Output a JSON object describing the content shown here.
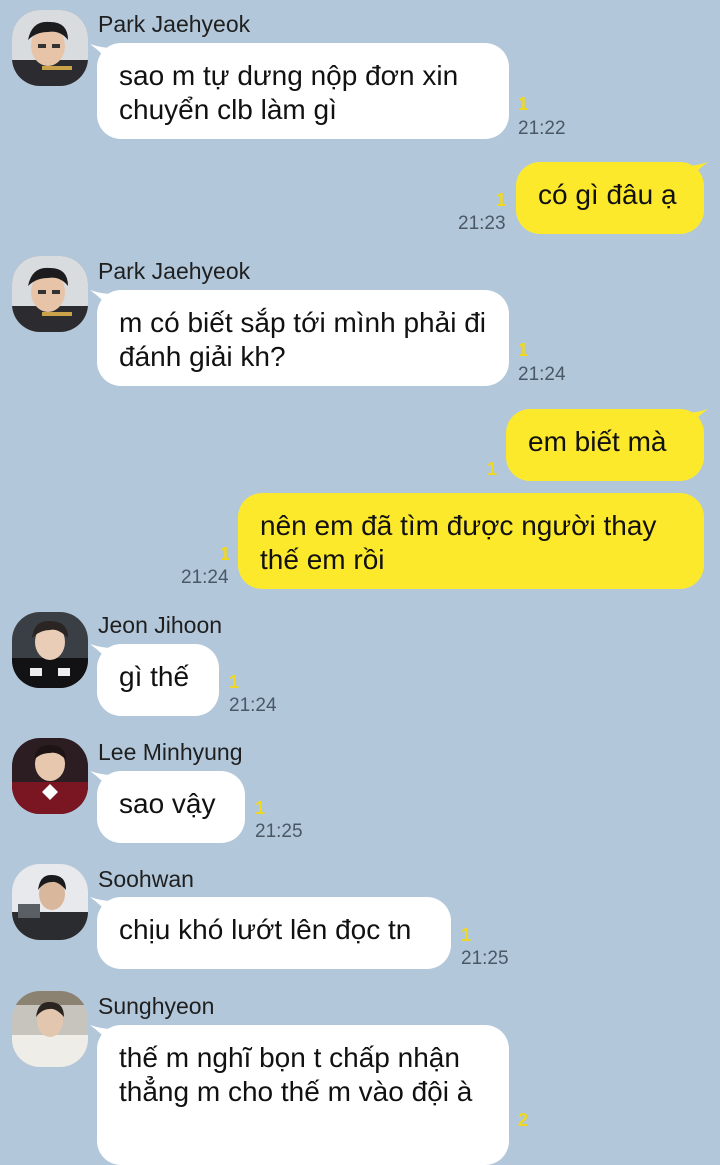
{
  "colors": {
    "background": "#b2c7da",
    "incoming_bubble": "#ffffff",
    "outgoing_bubble": "#fde92c",
    "unread_count": "#f1d81b",
    "time_text": "#4a5866"
  },
  "messages": [
    {
      "sender": "Park Jaehyeok",
      "avatar": "avatar-park-jaehyeok",
      "text": "sao m tự dưng nộp đơn xin chuyển clb làm gì",
      "unread": "1",
      "time": "21:22",
      "direction": "incoming"
    },
    {
      "text": "có gì đâu ạ",
      "unread": "1",
      "time": "21:23",
      "direction": "outgoing"
    },
    {
      "sender": "Park Jaehyeok",
      "avatar": "avatar-park-jaehyeok",
      "text": "m có biết sắp tới mình phải đi đánh giải kh?",
      "unread": "1",
      "time": "21:24",
      "direction": "incoming"
    },
    {
      "text": "em biết mà",
      "unread": "1",
      "time": "",
      "direction": "outgoing"
    },
    {
      "text": "nên em đã tìm được người thay thế em rồi",
      "unread": "1",
      "time": "21:24",
      "direction": "outgoing"
    },
    {
      "sender": "Jeon Jihoon",
      "avatar": "avatar-jeon-jihoon",
      "text": "gì thế",
      "unread": "1",
      "time": "21:24",
      "direction": "incoming"
    },
    {
      "sender": "Lee Minhyung",
      "avatar": "avatar-lee-minhyung",
      "text": "sao vậy",
      "unread": "1",
      "time": "21:25",
      "direction": "incoming"
    },
    {
      "sender": "Soohwan",
      "avatar": "avatar-soohwan",
      "text": "chịu khó lướt lên đọc tn",
      "unread": "1",
      "time": "21:25",
      "direction": "incoming"
    },
    {
      "sender": "Sunghyeon",
      "avatar": "avatar-sunghyeon",
      "text": "thế m nghĩ bọn t chấp nhận thẳng m cho thế m vào đội à",
      "unread": "2",
      "time": "",
      "direction": "incoming"
    }
  ]
}
